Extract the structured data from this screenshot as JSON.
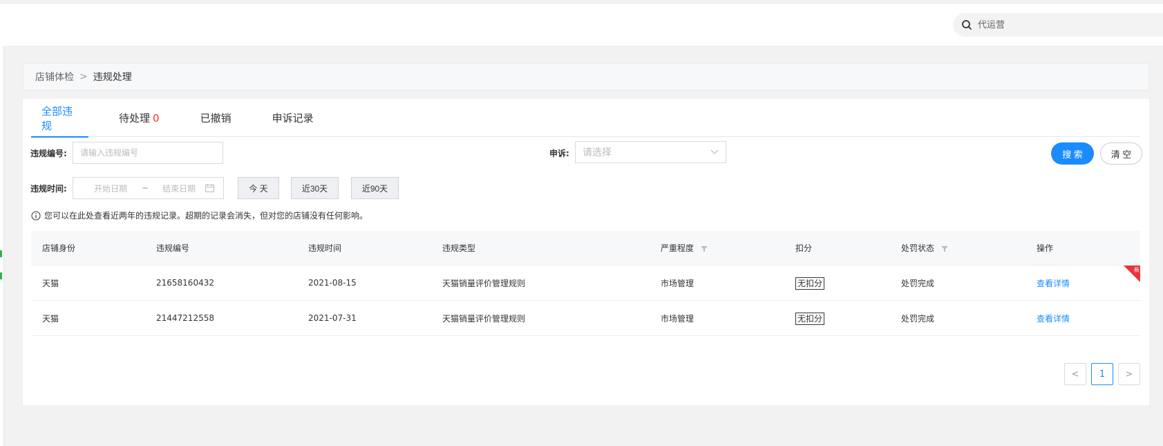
{
  "header": {
    "search_placeholder": "代运营"
  },
  "breadcrumb": {
    "parent": "店铺体检",
    "separator": ">",
    "current": "违规处理"
  },
  "tabs": [
    {
      "label": "全部违规",
      "active": true
    },
    {
      "label": "待处理",
      "count": "0"
    },
    {
      "label": "已撤销"
    },
    {
      "label": "申诉记录"
    }
  ],
  "filters": {
    "id_label": "违规编号:",
    "id_placeholder": "请输入违规编号",
    "appeal_label": "申诉:",
    "appeal_placeholder": "请选择",
    "search_button": "搜 索",
    "clear_button": "清 空",
    "time_label": "违规时间:",
    "start_placeholder": "开始日期",
    "range_separator": "~",
    "end_placeholder": "结束日期",
    "today_button": "今 天",
    "last30_button": "近30天",
    "last90_button": "近90天"
  },
  "notice": "您可以在此处查看近两年的违规记录。超期的记录会消失，但对您的店铺没有任何影响。",
  "table": {
    "columns": [
      "店铺身份",
      "违规编号",
      "违规时间",
      "违规类型",
      "严重程度",
      "扣分",
      "处罚状态",
      "操作"
    ],
    "rows": [
      {
        "identity": "天猫",
        "id": "21658160432",
        "time": "2021-08-15",
        "type": "天猫销量评价管理规则",
        "severity": "市场管理",
        "deduct": "无扣分",
        "status": "处罚完成",
        "action": "查看详情",
        "new_badge": "新"
      },
      {
        "identity": "天猫",
        "id": "21447212558",
        "time": "2021-07-31",
        "type": "天猫销量评价管理规则",
        "severity": "市场管理",
        "deduct": "无扣分",
        "status": "处罚完成",
        "action": "查看详情"
      }
    ]
  },
  "pagination": {
    "current": "1",
    "prev": "<",
    "next": ">"
  },
  "colors": {
    "accent": "#1a8cff",
    "count": "#ff3333",
    "new_badge": "#e8353b"
  }
}
